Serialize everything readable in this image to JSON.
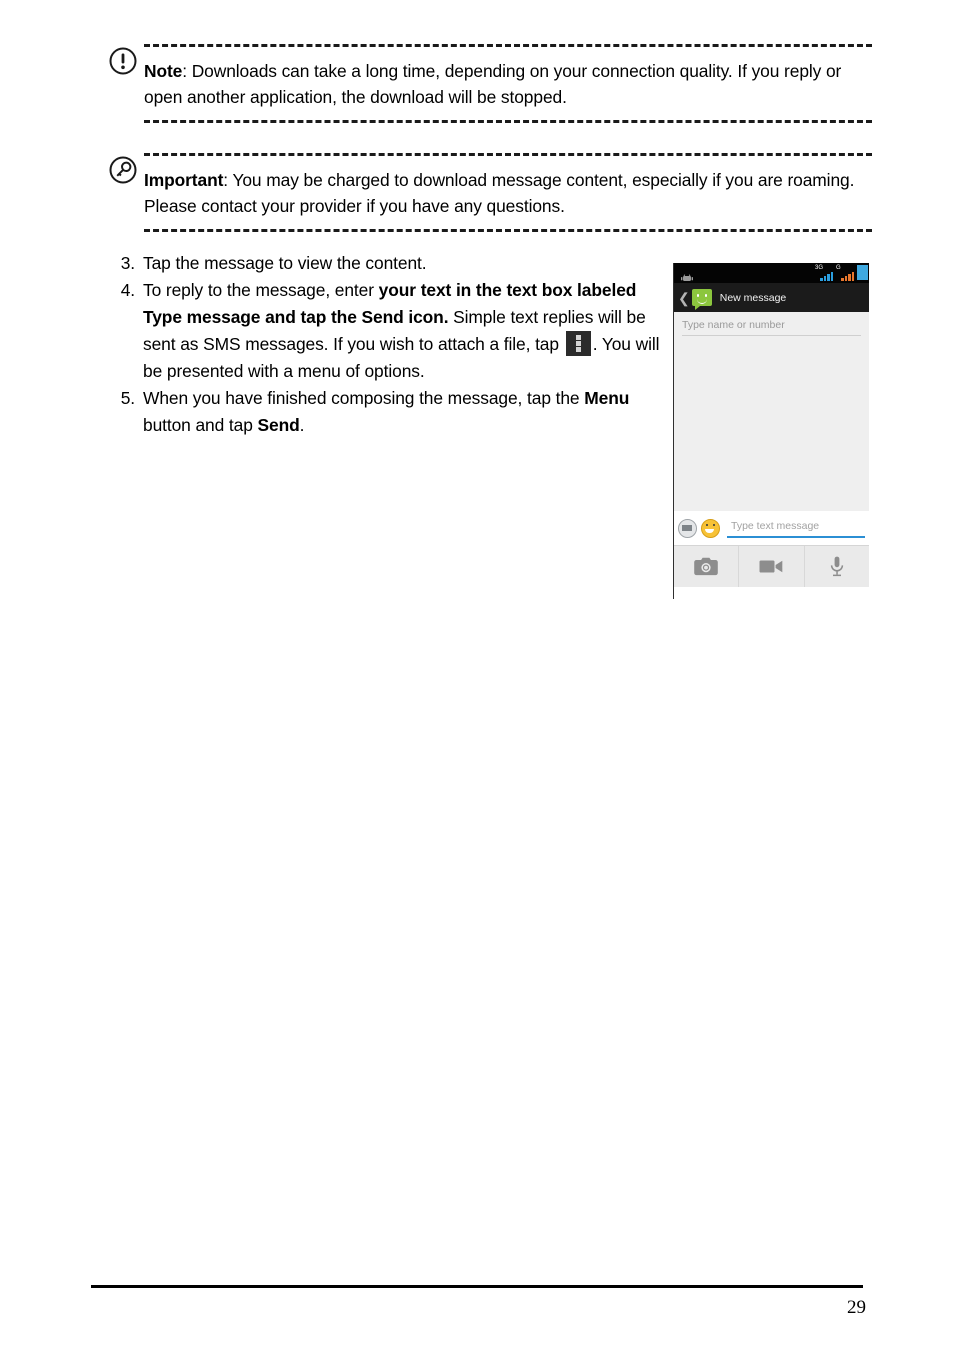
{
  "note": {
    "icon": "exclamation-circle-icon",
    "label": "Note",
    "separator": ": ",
    "text": "Downloads can take a long time, depending on your connection quality. If you reply or open another application, the download will be stopped."
  },
  "important": {
    "icon": "key-circle-icon",
    "label": "Important",
    "separator": ": ",
    "text": "You may be charged to download message content, especially if you are roaming. Please contact your provider if you have any questions."
  },
  "steps": [
    {
      "number": "3.",
      "parts": [
        {
          "text": "Tap the message to view the content.",
          "bold": false
        }
      ]
    },
    {
      "number": "4.",
      "parts": [
        {
          "text": "To reply to the message, enter ",
          "bold": false
        },
        {
          "text": "your text in the text box labeled Type message and tap the Send icon.",
          "bold": true
        },
        {
          "text": " Simple text replies will be sent as SMS messages. If you wish to attach a file, tap ",
          "bold": false
        },
        {
          "icon": "overflow-menu-icon"
        },
        {
          "text": ". You will be presented with a menu of options.",
          "bold": false
        }
      ]
    },
    {
      "number": "5.",
      "parts": [
        {
          "text": "When you have finished composing the message, tap the ",
          "bold": false
        },
        {
          "text": "Menu",
          "bold": true
        },
        {
          "text": " button and tap ",
          "bold": false
        },
        {
          "text": "Send",
          "bold": true
        },
        {
          "text": ".",
          "bold": false
        }
      ]
    }
  ],
  "phone": {
    "status_bar": {
      "notification_icon": "android-robot-icon",
      "signal_1": {
        "label": "3G",
        "icon": "signal-bars-icon",
        "color": "#2b9fe0"
      },
      "signal_2": {
        "label": "G",
        "icon": "signal-bars-icon",
        "color": "#e8762c"
      },
      "battery_icon": "battery-icon",
      "battery_color": "#3fa9e0"
    },
    "action_bar": {
      "back_icon": "back-chevron-icon",
      "app_icon": "messaging-app-icon",
      "app_icon_color": "#8cc63e",
      "title": "New message"
    },
    "recipient_field": {
      "placeholder": "Type name or number",
      "value": ""
    },
    "compose": {
      "keyboard_icon": "keyboard-icon",
      "emoji_icon": "emoji-icon",
      "placeholder": "Type text message",
      "value": "",
      "underline_color": "#2b8fd4"
    },
    "attachments": [
      {
        "icon": "camera-icon"
      },
      {
        "icon": "video-camera-icon"
      },
      {
        "icon": "microphone-icon"
      }
    ]
  },
  "footer": {
    "page_number": "29"
  }
}
